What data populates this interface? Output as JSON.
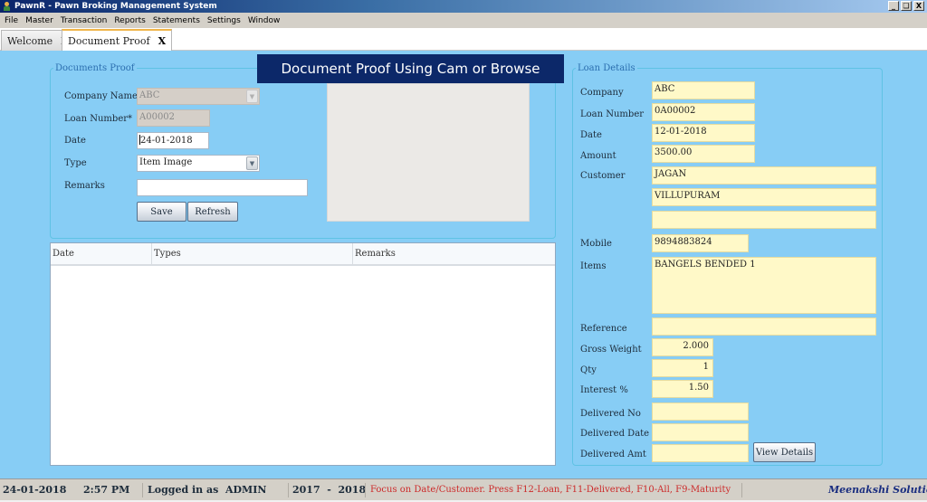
{
  "window": {
    "title": "PawnR - Pawn Broking Management System",
    "buttons": {
      "minimize": "_",
      "restore": "❏",
      "close": "X"
    }
  },
  "menu": [
    "File",
    "Master",
    "Transaction",
    "Reports",
    "Statements",
    "Settings",
    "Window"
  ],
  "tabs": [
    {
      "label": "Welcome",
      "close": "X",
      "active": false
    },
    {
      "label": "Document Proof",
      "close": "X",
      "active": true
    }
  ],
  "banner": "Document Proof Using Cam or Browse",
  "documents_proof": {
    "legend": "Documents Proof",
    "company_name": {
      "label": "Company Name",
      "value": "ABC"
    },
    "loan_number": {
      "label": "Loan Number*",
      "value": "A00002"
    },
    "date": {
      "label": "Date",
      "value": "24-01-2018"
    },
    "type": {
      "label": "Type",
      "value": "Item Image"
    },
    "remarks": {
      "label": "Remarks",
      "value": ""
    },
    "save_label": "Save",
    "refresh_label": "Refresh"
  },
  "grid": {
    "columns": [
      "Date",
      "Types",
      "Remarks"
    ],
    "rows": []
  },
  "loan_details": {
    "legend": "Loan Details",
    "company": {
      "label": "Company",
      "value": "ABC"
    },
    "loan_number": {
      "label": "Loan Number",
      "value": "0A00002"
    },
    "date": {
      "label": "Date",
      "value": "12-01-2018"
    },
    "amount": {
      "label": "Amount",
      "value": "3500.00"
    },
    "customer": {
      "label": "Customer",
      "line1": "JAGAN",
      "line2": "VILLUPURAM",
      "line3": ""
    },
    "mobile": {
      "label": "Mobile",
      "value": "9894883824"
    },
    "items": {
      "label": "Items",
      "value": "BANGELS BENDED 1"
    },
    "reference": {
      "label": "Reference",
      "value": ""
    },
    "gross_weight": {
      "label": "Gross Weight",
      "value": "2.000"
    },
    "qty": {
      "label": "Qty",
      "value": "1"
    },
    "interest": {
      "label": "Interest %",
      "value": "1.50"
    },
    "delivered_no": {
      "label": "Delivered No",
      "value": ""
    },
    "delivered_date": {
      "label": "Delivered Date",
      "value": ""
    },
    "delivered_amt": {
      "label": "Delivered Amt",
      "value": ""
    },
    "view_details_label": "View Details"
  },
  "status": {
    "date": "24-01-2018",
    "time": "2:57 PM",
    "logged_in_prefix": "Logged in as",
    "user": "ADMIN",
    "fiscal_year": "2017  -  2018",
    "hint": "Focus on Date/Customer. Press F12-Loan, F11-Delivered, F10-All, F9-Maturity",
    "brand": "Meenakshi Solutions"
  },
  "colors": {
    "content_bg": "#87cdf5",
    "banner_bg": "#0c2869",
    "readonly_field": "#fff9c8",
    "hint_text": "#cc2a2a",
    "brand_text": "#1a2e80"
  }
}
